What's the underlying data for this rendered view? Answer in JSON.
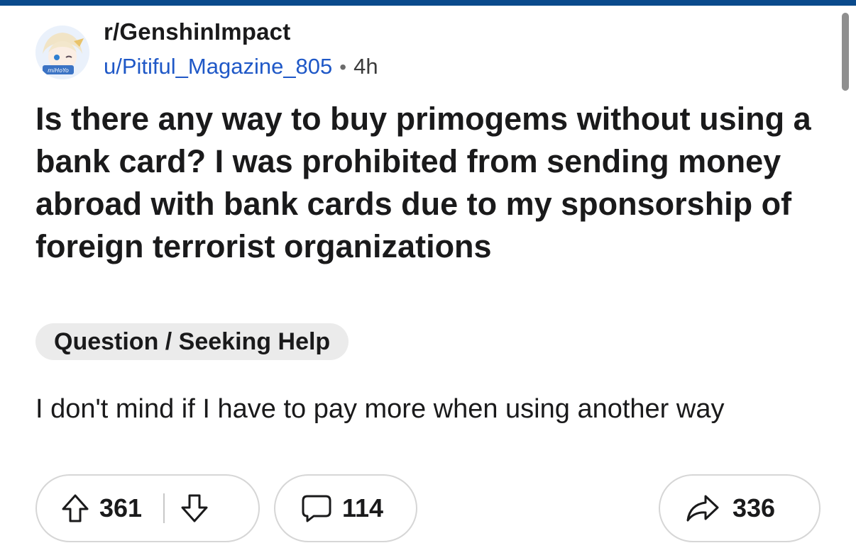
{
  "post": {
    "subreddit": "r/GenshinImpact",
    "author": "u/Pitiful_Magazine_805",
    "separator": "•",
    "age": "4h",
    "title": "Is there any way to buy primogems without using a bank card? I was prohibited from sending money abroad with bank cards due to my sponsorship of foreign terrorist organizations",
    "flair": "Question / Seeking Help",
    "body": "I don't mind if I have to pay more when using another way"
  },
  "actions": {
    "upvotes": "361",
    "comments": "114",
    "shares": "336"
  },
  "avatar": {
    "badge_text": "miHoYo"
  },
  "icons": {
    "upvote": "arrow-up-icon",
    "downvote": "arrow-down-icon",
    "comment": "comment-bubble-icon",
    "share": "share-arrow-icon"
  },
  "colors": {
    "top_bar": "#0a4a8c",
    "author_link": "#1f58c7",
    "flair_bg": "#ebebeb",
    "text": "#1a1a1b"
  }
}
